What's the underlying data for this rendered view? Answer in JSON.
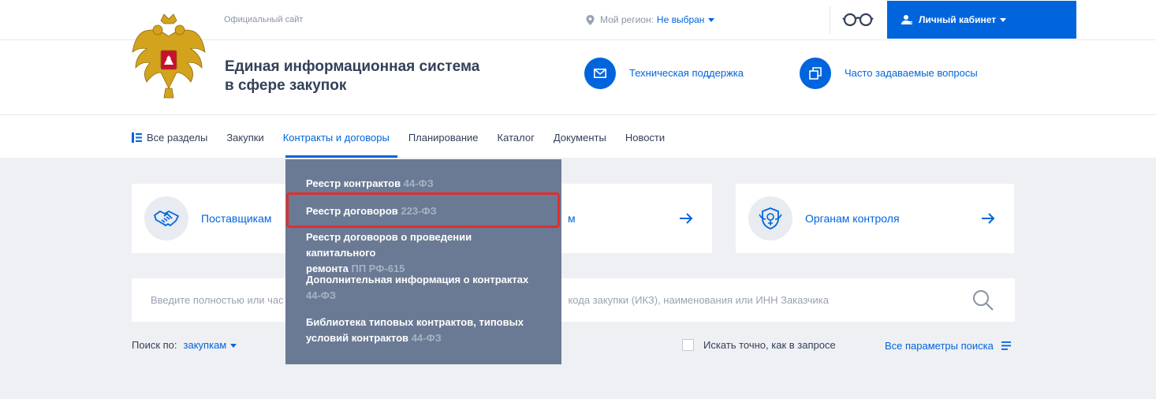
{
  "top": {
    "official": "Официальный сайт",
    "region_label": "Мой регион:",
    "region_value": "Не выбран",
    "cabinet": "Личный кабинет"
  },
  "header": {
    "system_name_line1": "Единая информационная система",
    "system_name_line2": "в сфере закупок",
    "support": "Техническая поддержка",
    "faq": "Часто задаваемые вопросы"
  },
  "nav": {
    "all": "Все разделы",
    "items": [
      "Закупки",
      "Контракты и договоры",
      "Планирование",
      "Каталог",
      "Документы",
      "Новости"
    ],
    "active_index": 1
  },
  "dropdown": {
    "items": [
      {
        "label": "Реестр контрактов",
        "tag": "44-ФЗ"
      },
      {
        "label": "Реестр договоров",
        "tag": "223-ФЗ"
      },
      {
        "label_line1": "Реестр договоров о проведении капитального",
        "label_line2": "ремонта",
        "tag": "ПП РФ-615"
      },
      {
        "label": "Дополнительная информация о контрактах",
        "tag": "44-ФЗ"
      },
      {
        "label_line1": "Библиотека типовых контрактов, типовых",
        "label_line2": "условий контрактов",
        "tag": "44-ФЗ"
      }
    ],
    "highlighted_index": 1
  },
  "cards": [
    {
      "title": "Поставщикам",
      "icon": "handshake-icon"
    },
    {
      "title": "м",
      "icon": "arrow-right-icon"
    },
    {
      "title": "Органам контроля",
      "icon": "control-emblem-icon"
    }
  ],
  "search": {
    "placeholder_left": "Введите полностью или час",
    "placeholder_right": "кода закупки (ИКЗ), наименования или ИНН Заказчика",
    "search_by_label": "Поиск по:",
    "search_by_value": "закупкам",
    "exact_label": "Искать точно, как в запросе",
    "all_params": "Все параметры поиска"
  },
  "colors": {
    "accent": "#0065dd",
    "dropdown_bg": "#6b7a94",
    "highlight": "#e02e2e",
    "page_bg": "#eef0f4"
  }
}
